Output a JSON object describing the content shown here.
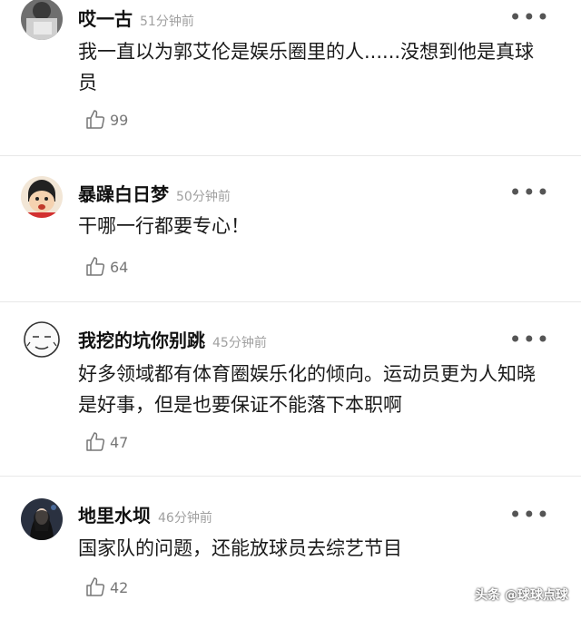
{
  "comments": [
    {
      "username": "哎一古",
      "time": "51分钟前",
      "text": "我一直以为郭艾伦是娱乐圈里的人......没想到他是真球员",
      "likes": "99"
    },
    {
      "username": "暴躁白日梦",
      "time": "50分钟前",
      "text": "干哪一行都要专心！",
      "likes": "64"
    },
    {
      "username": "我挖的坑你别跳",
      "time": "45分钟前",
      "text": "好多领域都有体育圈娱乐化的倾向。运动员更为人知晓是好事，但是也要保证不能落下本职啊",
      "likes": "47"
    },
    {
      "username": "地里水坝",
      "time": "46分钟前",
      "text": "国家队的问题，还能放球员去综艺节目",
      "likes": "42"
    }
  ],
  "more_label": "•••",
  "watermark": "头条 @球球点球"
}
